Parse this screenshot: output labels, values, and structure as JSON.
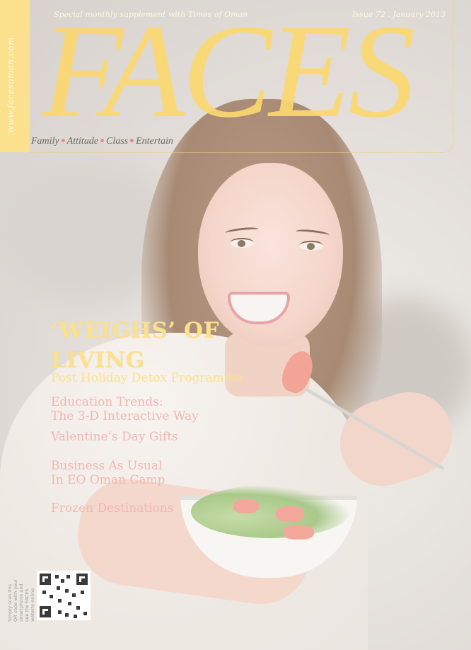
{
  "header": {
    "supplement": "Special monthly supplement with Times of Oman",
    "issue": "Issue 72 . January 2013",
    "masthead": "FACES",
    "url": "www.facesoman.com",
    "tagline": [
      "Family",
      "Attitude",
      "Class",
      "Entertain"
    ]
  },
  "colors": {
    "masthead": "#fcd870",
    "headline": "#fbe18e",
    "story": "#f2b6b1",
    "dot": "#e88b86"
  },
  "cover_lines": {
    "headline_line1": "‘WEIGHS’ OF",
    "headline_line2": "LIVING",
    "subhead": "Post Holiday Detox Programme",
    "stories": [
      {
        "line1": "Education Trends:",
        "line2": "The 3-D Interactive Way"
      },
      {
        "line1": "Valentine’s Day Gifts",
        "line2": ""
      },
      {
        "line1": "Business As Usual",
        "line2": "In EO Oman Camp"
      },
      {
        "line1": "Frozen Destinations",
        "line2": ""
      }
    ]
  },
  "qr": {
    "caption": "Simply scan this QR code with your smartphone and see the FACES website online",
    "icon": "qr-code-icon"
  }
}
